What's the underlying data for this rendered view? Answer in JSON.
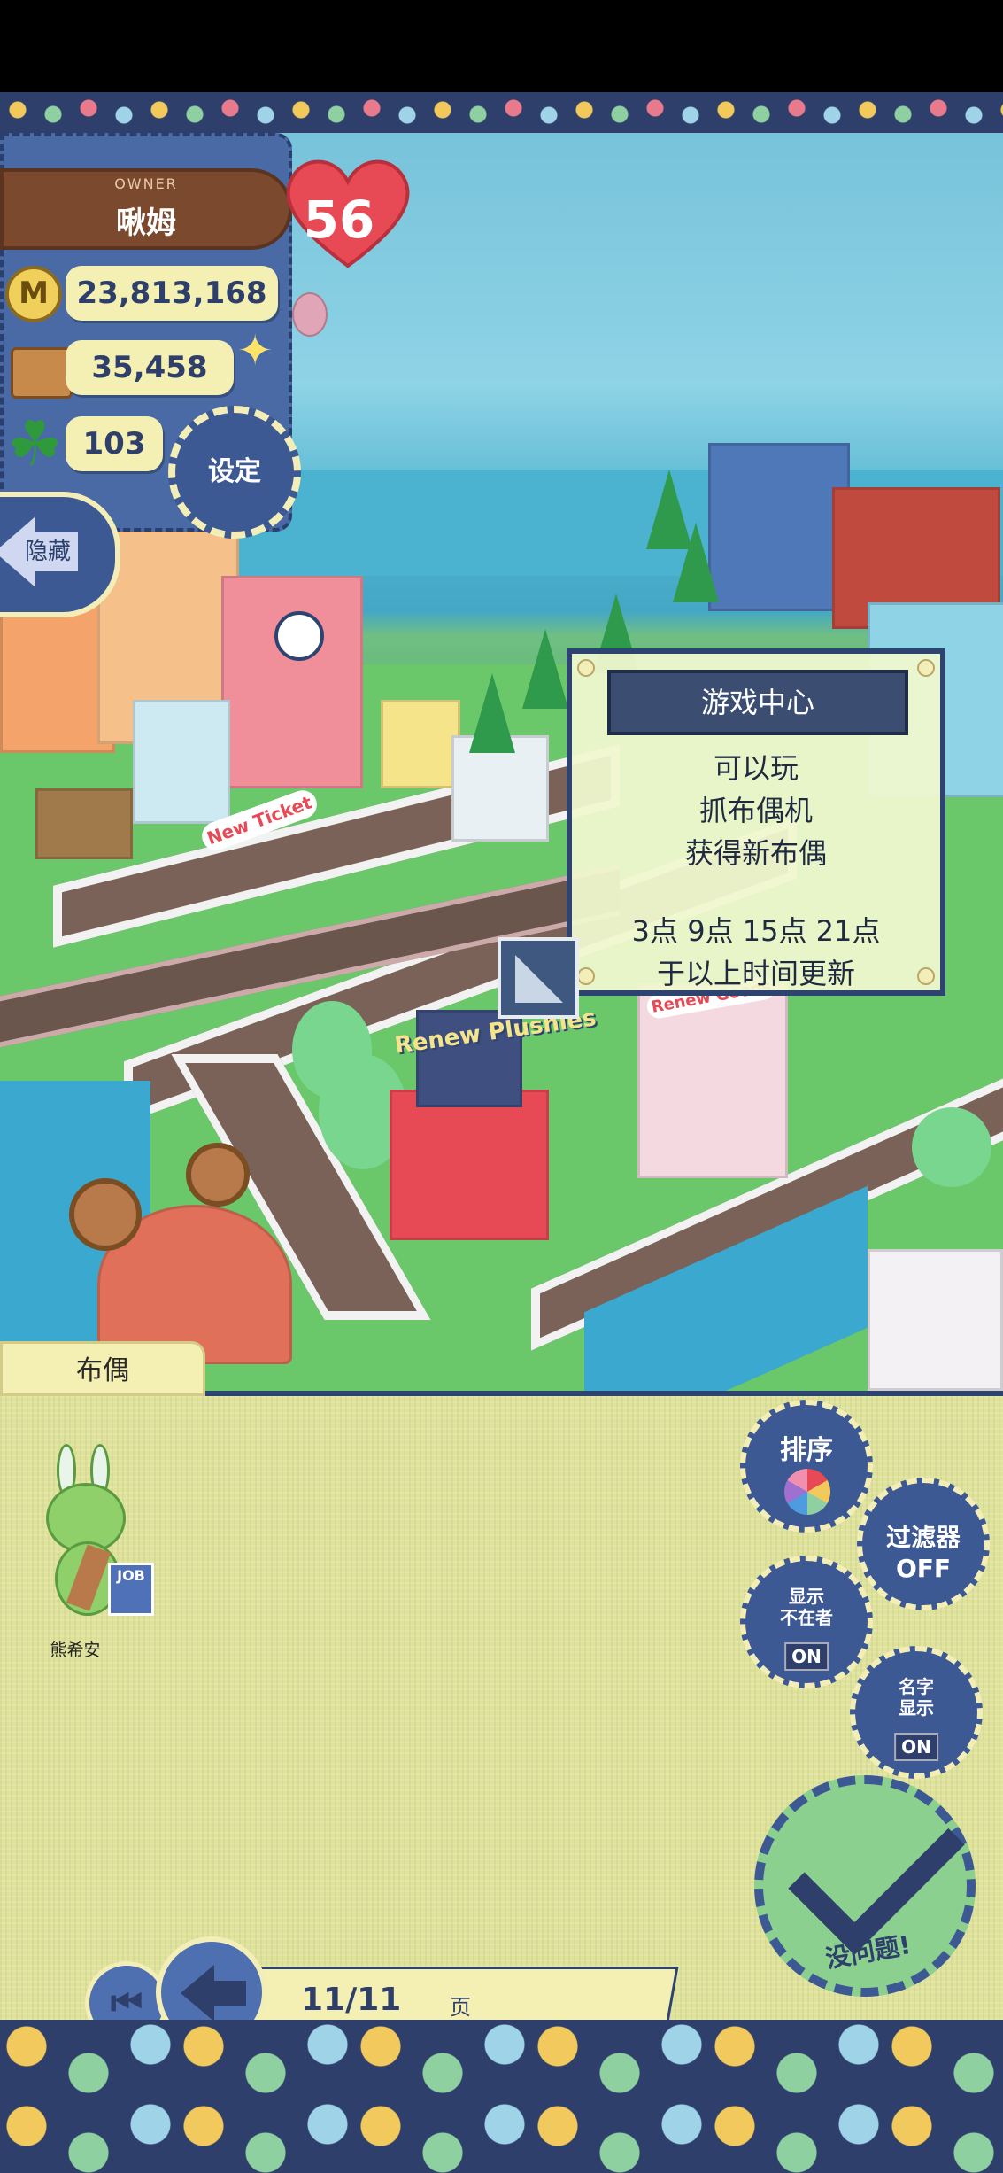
{
  "hud": {
    "owner_label": "OWNER",
    "owner_name": "啾姆",
    "level": "56",
    "coins": "23,813,168",
    "coin_symbol": "M",
    "goods": "35,458",
    "clovers": "103",
    "settings_label": "设定",
    "hide_label": "隐藏"
  },
  "popup": {
    "title": "游戏中心",
    "lines": [
      "可以玩",
      "抓布偶机",
      "获得新布偶",
      "",
      "3点 9点 15点 21点",
      "于以上时间更新"
    ]
  },
  "panel": {
    "tab_label": "布偶",
    "buttons": {
      "sort": "排序",
      "filter": "过滤器",
      "filter_state": "OFF",
      "show_absent": "显示\n不在者",
      "show_absent_state": "ON",
      "show_name": "名字\n显示",
      "show_name_state": "ON",
      "ok": "没问题!"
    },
    "items": [
      {
        "name": "熊希安",
        "tag": "JOB"
      }
    ]
  },
  "pager": {
    "page": "11/11",
    "unit": "页",
    "first_icon": "⏮"
  },
  "world_signs": {
    "new_ticket": "New Ticket",
    "renew_plushies": "Renew Plushies",
    "renew_goods": "Renew Goods"
  },
  "colors": {
    "navy": "#2e4470",
    "cream": "#f4efb2",
    "panel_green": "#dfe39a",
    "accent_red": "#e84a55"
  }
}
